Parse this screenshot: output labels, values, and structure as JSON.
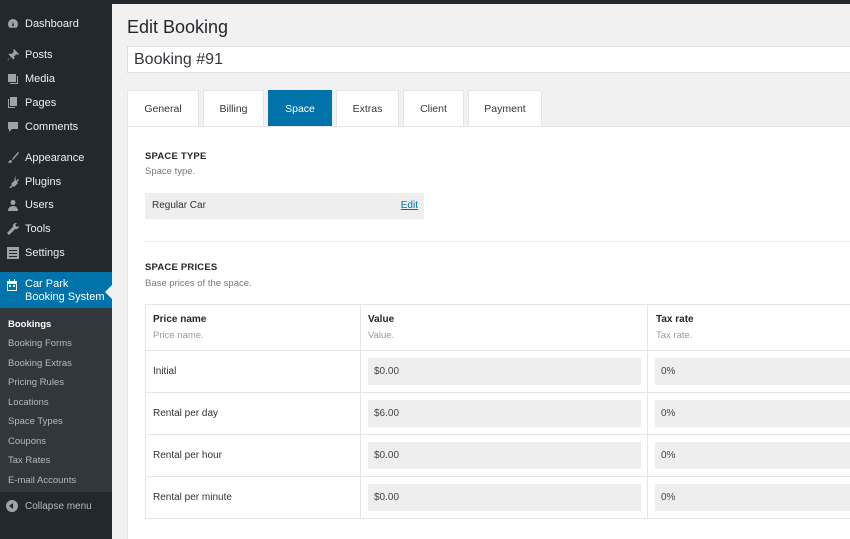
{
  "sidebar": {
    "items": [
      {
        "label": "Dashboard",
        "icon": "dashboard-icon"
      },
      {
        "label": "Posts",
        "icon": "pin-icon"
      },
      {
        "label": "Media",
        "icon": "media-icon"
      },
      {
        "label": "Pages",
        "icon": "pages-icon"
      },
      {
        "label": "Comments",
        "icon": "comment-icon"
      },
      {
        "label": "Appearance",
        "icon": "brush-icon"
      },
      {
        "label": "Plugins",
        "icon": "plug-icon"
      },
      {
        "label": "Users",
        "icon": "user-icon"
      },
      {
        "label": "Tools",
        "icon": "wrench-icon"
      },
      {
        "label": "Settings",
        "icon": "settings-icon"
      }
    ],
    "active": {
      "label": "Car Park Booking System",
      "icon": "calendar-icon"
    },
    "submenu": [
      "Bookings",
      "Booking Forms",
      "Booking Extras",
      "Pricing Rules",
      "Locations",
      "Space Types",
      "Coupons",
      "Tax Rates",
      "E-mail Accounts"
    ],
    "collapse": "Collapse menu"
  },
  "page": {
    "title": "Edit Booking",
    "booking_title": "Booking #91"
  },
  "tabs": [
    "General",
    "Billing",
    "Space",
    "Extras",
    "Client",
    "Payment"
  ],
  "space_type": {
    "heading": "SPACE TYPE",
    "description": "Space type.",
    "value": "Regular Car",
    "edit_link": "Edit"
  },
  "space_prices": {
    "heading": "SPACE PRICES",
    "description": "Base prices of the space.",
    "columns": [
      {
        "title": "Price name",
        "sub": "Price name."
      },
      {
        "title": "Value",
        "sub": "Value."
      },
      {
        "title": "Tax rate",
        "sub": "Tax rate."
      }
    ],
    "rows": [
      {
        "name": "Initial",
        "value": "$0.00",
        "tax": "0%"
      },
      {
        "name": "Rental per day",
        "value": "$6.00",
        "tax": "0%"
      },
      {
        "name": "Rental per hour",
        "value": "$0.00",
        "tax": "0%"
      },
      {
        "name": "Rental per minute",
        "value": "$0.00",
        "tax": "0%"
      }
    ]
  },
  "colors": {
    "accent": "#0073aa",
    "sidebar": "#23282d",
    "submenu": "#32373c"
  }
}
